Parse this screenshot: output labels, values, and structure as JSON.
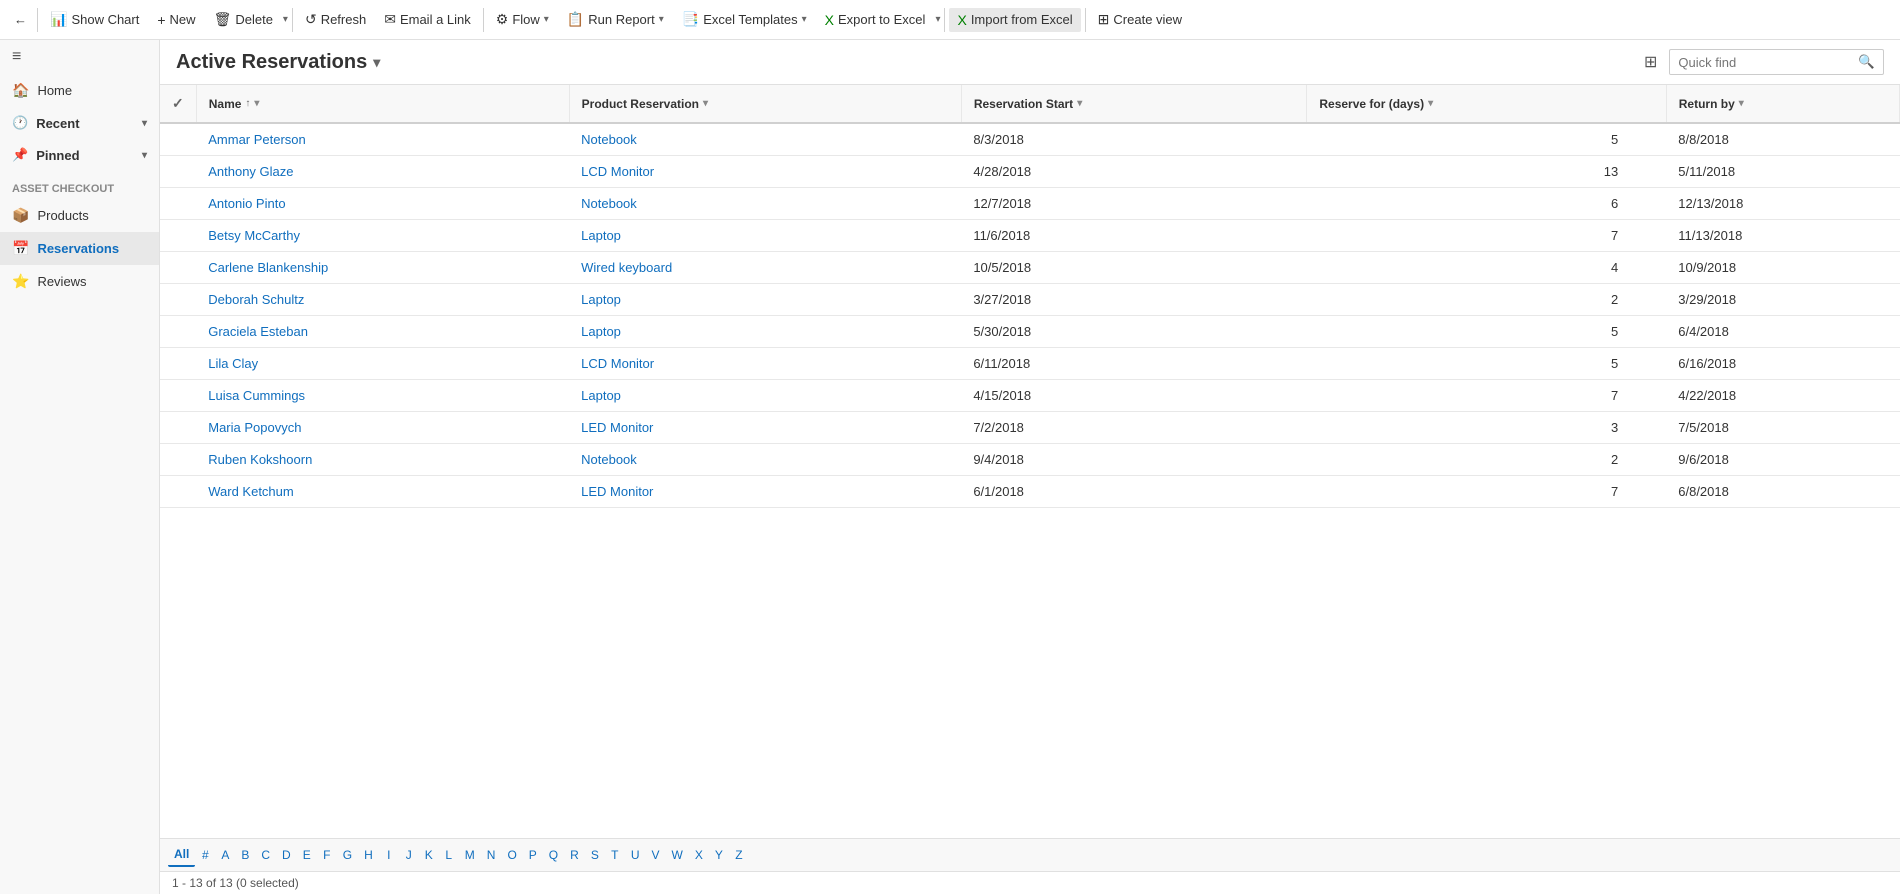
{
  "toolbar": {
    "back_label": "←",
    "show_chart_label": "Show Chart",
    "new_label": "New",
    "delete_label": "Delete",
    "refresh_label": "Refresh",
    "email_link_label": "Email a Link",
    "flow_label": "Flow",
    "run_report_label": "Run Report",
    "excel_templates_label": "Excel Templates",
    "export_excel_label": "Export to Excel",
    "import_excel_label": "Import from Excel",
    "create_view_label": "Create view"
  },
  "sidebar": {
    "menu_icon": "≡",
    "home_label": "Home",
    "recent_label": "Recent",
    "pinned_label": "Pinned",
    "group_label": "Asset Checkout",
    "products_label": "Products",
    "reservations_label": "Reservations",
    "reviews_label": "Reviews"
  },
  "header": {
    "title": "Active Reservations",
    "chevron": "▾",
    "filter_icon": "⊞",
    "quick_find_placeholder": "Quick find",
    "search_icon": "🔍"
  },
  "columns": [
    {
      "key": "name",
      "label": "Name",
      "sort": "↑",
      "filter": "▾"
    },
    {
      "key": "product",
      "label": "Product Reservation",
      "filter": "▾"
    },
    {
      "key": "start",
      "label": "Reservation Start",
      "filter": "▾"
    },
    {
      "key": "days",
      "label": "Reserve for (days)",
      "filter": "▾"
    },
    {
      "key": "return",
      "label": "Return by",
      "filter": "▾"
    }
  ],
  "rows": [
    {
      "name": "Ammar Peterson",
      "product": "Notebook",
      "start": "8/3/2018",
      "days": "5",
      "return": "8/8/2018"
    },
    {
      "name": "Anthony Glaze",
      "product": "LCD Monitor",
      "start": "4/28/2018",
      "days": "13",
      "return": "5/11/2018"
    },
    {
      "name": "Antonio Pinto",
      "product": "Notebook",
      "start": "12/7/2018",
      "days": "6",
      "return": "12/13/2018"
    },
    {
      "name": "Betsy McCarthy",
      "product": "Laptop",
      "start": "11/6/2018",
      "days": "7",
      "return": "11/13/2018"
    },
    {
      "name": "Carlene Blankenship",
      "product": "Wired keyboard",
      "start": "10/5/2018",
      "days": "4",
      "return": "10/9/2018"
    },
    {
      "name": "Deborah Schultz",
      "product": "Laptop",
      "start": "3/27/2018",
      "days": "2",
      "return": "3/29/2018"
    },
    {
      "name": "Graciela Esteban",
      "product": "Laptop",
      "start": "5/30/2018",
      "days": "5",
      "return": "6/4/2018"
    },
    {
      "name": "Lila Clay",
      "product": "LCD Monitor",
      "start": "6/11/2018",
      "days": "5",
      "return": "6/16/2018"
    },
    {
      "name": "Luisa Cummings",
      "product": "Laptop",
      "start": "4/15/2018",
      "days": "7",
      "return": "4/22/2018"
    },
    {
      "name": "Maria Popovych",
      "product": "LED Monitor",
      "start": "7/2/2018",
      "days": "3",
      "return": "7/5/2018"
    },
    {
      "name": "Ruben Kokshoorn",
      "product": "Notebook",
      "start": "9/4/2018",
      "days": "2",
      "return": "9/6/2018"
    },
    {
      "name": "Ward Ketchum",
      "product": "LED Monitor",
      "start": "6/1/2018",
      "days": "7",
      "return": "6/8/2018"
    }
  ],
  "pagination": {
    "letters": [
      "All",
      "#",
      "A",
      "B",
      "C",
      "D",
      "E",
      "F",
      "G",
      "H",
      "I",
      "J",
      "K",
      "L",
      "M",
      "N",
      "O",
      "P",
      "Q",
      "R",
      "S",
      "T",
      "U",
      "V",
      "W",
      "X",
      "Y",
      "Z"
    ],
    "active": "All"
  },
  "status": {
    "text": "1 - 13 of 13 (0 selected)"
  },
  "colors": {
    "link": "#106ebe",
    "accent": "#106ebe"
  }
}
